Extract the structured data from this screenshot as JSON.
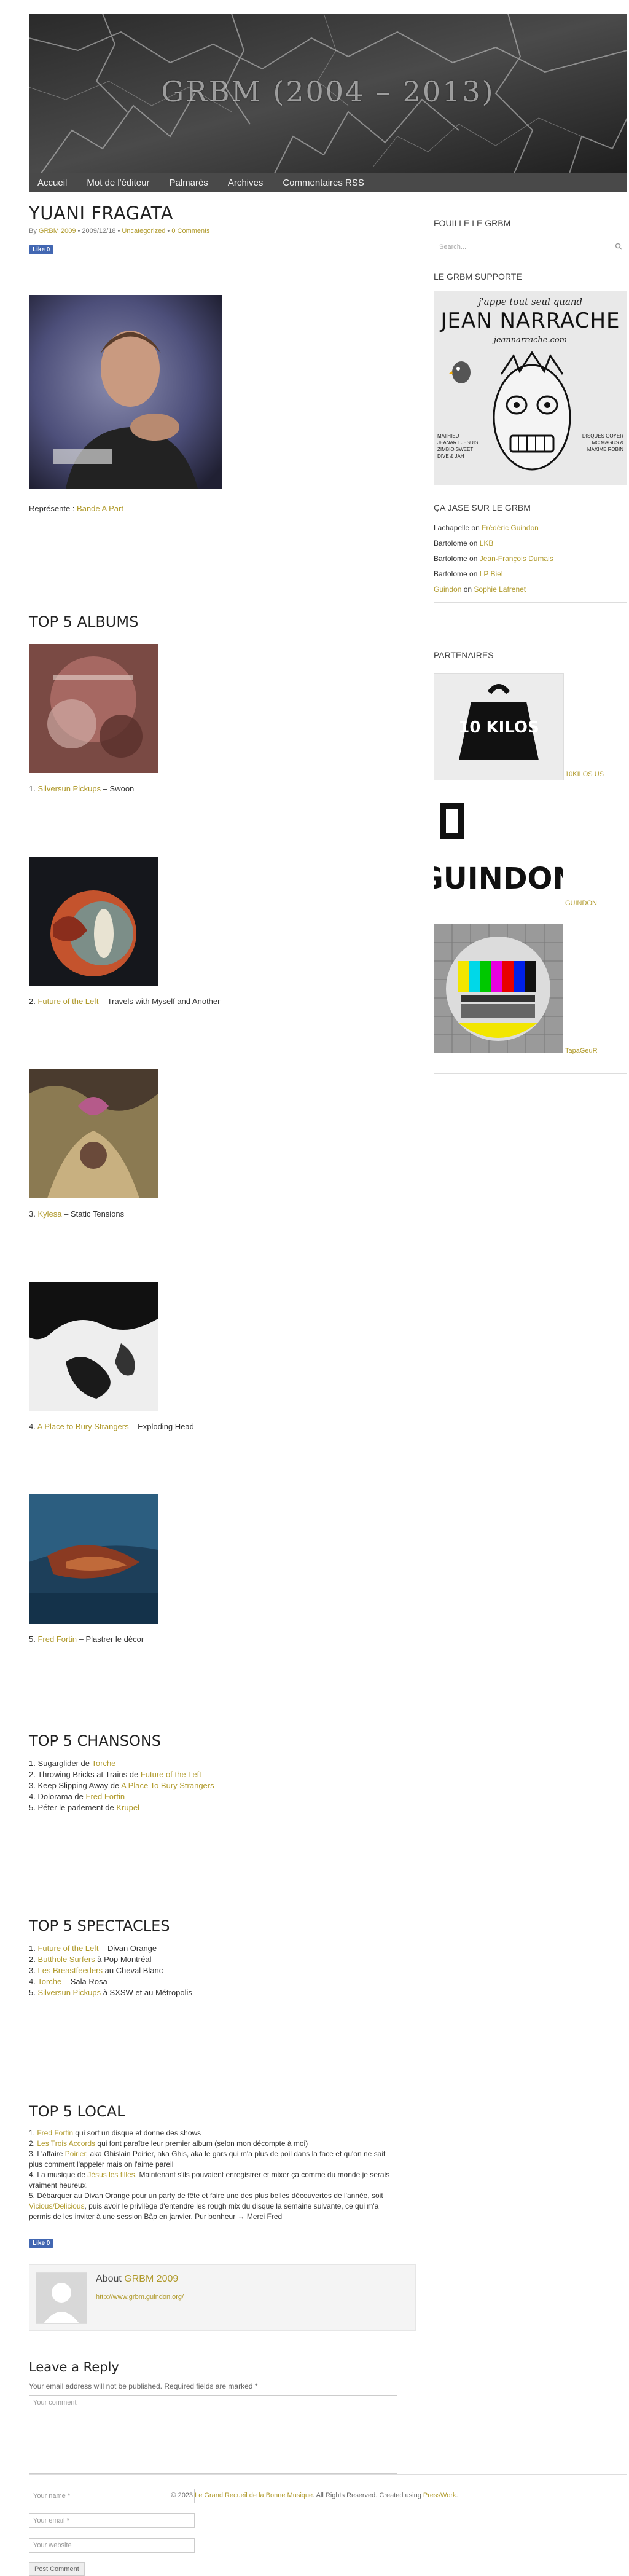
{
  "header": {
    "title": "GRBM (2004 – 2013)"
  },
  "nav": [
    "Accueil",
    "Mot de l'éditeur",
    "Palmarès",
    "Archives",
    "Commentaires RSS"
  ],
  "post": {
    "title": "YUANI FRAGATA",
    "meta_by": "By",
    "meta_author": "GRBM 2009",
    "meta_date": " • 2009/12/18 • ",
    "meta_category": "Uncategorized",
    "meta_sep": " • ",
    "meta_comments": "0 Comments",
    "like": "Like 0",
    "represents_label": "Représente : ",
    "represents_link": "Bande A Part"
  },
  "top_albums": {
    "heading": "TOP 5 ALBUMS",
    "items": [
      {
        "num": "1. ",
        "artist": "Silversun Pickups",
        "title": " – Swoon"
      },
      {
        "num": "2. ",
        "artist": "Future of the Left",
        "title": " – Travels with Myself and Another"
      },
      {
        "num": "3. ",
        "artist": "Kylesa",
        "title": " – Static Tensions"
      },
      {
        "num": "4. ",
        "artist": "A Place to Bury Strangers",
        "title": " – Exploding Head"
      },
      {
        "num": "5. ",
        "artist": "Fred Fortin",
        "title": " – Plastrer le décor"
      }
    ]
  },
  "top_songs": {
    "heading": "TOP 5 CHANSONS",
    "items": [
      {
        "text": "1. Sugarglider de ",
        "link": "Torche",
        "after": ""
      },
      {
        "text": "2. Throwing Bricks at Trains de ",
        "link": "Future of the Left",
        "after": ""
      },
      {
        "text": "3. Keep Slipping Away de ",
        "link": "A Place To Bury Strangers",
        "after": ""
      },
      {
        "text": "4. Dolorama de ",
        "link": "Fred Fortin",
        "after": ""
      },
      {
        "text": "5. Péter le parlement de ",
        "link": "Krupel",
        "after": ""
      }
    ]
  },
  "top_shows": {
    "heading": "TOP 5 SPECTACLES",
    "items": [
      {
        "text": "1. ",
        "link": "Future of the Left",
        "after": " – Divan Orange"
      },
      {
        "text": "2. ",
        "link": "Butthole Surfers",
        "after": " à Pop Montréal"
      },
      {
        "text": "3. ",
        "link": "Les Breastfeeders",
        "after": " au Cheval Blanc"
      },
      {
        "text": "4. ",
        "link": "Torche",
        "after": " – Sala Rosa"
      },
      {
        "text": "5. ",
        "link": "Silversun Pickups",
        "after": " à SXSW et au Métropolis"
      }
    ]
  },
  "top_local": {
    "heading": "TOP 5 LOCAL",
    "l1a": "1. ",
    "l1link": "Fred Fortin",
    "l1b": " qui sort un disque et donne des shows",
    "l2a": "2. ",
    "l2link": "Les Trois Accords",
    "l2b": " qui font paraître leur premier album (selon mon décompte à moi)",
    "l3a": "3. L'affaire ",
    "l3link": "Poirier",
    "l3b": ", aka Ghislain Poirier, aka Ghis, aka le gars qui m'a plus de poil dans la face et qu'on ne sait",
    "l3c": "plus comment l'appeler mais on l'aime pareil",
    "l4a": "4. La musique de ",
    "l4link": "Jésus les filles",
    "l4b": ". Maintenant s'ils pouvaient enregistrer et mixer ça comme du monde je serais",
    "l4c": "vraiment heureux.",
    "l5a": "5. Débarquer au Divan Orange pour un party de fête et faire une des plus belles découvertes de l'année, soit",
    "l5link": "Vicious/Delicious",
    "l5b": ", puis avoir le privilège d'entendre les rough mix du disque la semaine suivante, ce qui m'a",
    "l5c": "permis de les inviter à une session Bâp en janvier. Pur bonheur → Merci Fred",
    "like": "Like 0"
  },
  "author_box": {
    "about": "About ",
    "name": "GRBM 2009",
    "url": "http://www.grbm.guindon.org/"
  },
  "reply": {
    "heading": "Leave a Reply",
    "note": "Your email address will not be published. Required fields are marked *",
    "comment_placeholder": "Your comment",
    "name_placeholder": "Your name *",
    "email_placeholder": "Your email *",
    "website_placeholder": "Your website",
    "submit": "Post Comment"
  },
  "sidebar": {
    "search_heading": "FOUILLE LE GRBM",
    "search_placeholder": "Search...",
    "supports_heading": "LE GRBM SUPPORTE",
    "ad_top_text": "j'appe tout seul quand",
    "ad_name": "JEAN NARRACHE",
    "ad_url": "jeannarrache.com",
    "ad_left_text": "MATHIEU JEANART JESUIS ZIMBIO SWEET DIVE & JAH",
    "ad_right_text": "DISQUES GOYER MC MAGUS & MAXIME ROBIN",
    "comments_heading": "ÇA JASE SUR LE GRBM",
    "comments": [
      {
        "who": "Lachapelle",
        "on": " on ",
        "post": "Frédéric Guindon"
      },
      {
        "who": "Bartolome",
        "on": " on ",
        "post": "LKB"
      },
      {
        "who": "Bartolome",
        "on": " on ",
        "post": "Jean-François Dumais"
      },
      {
        "who": "Bartolome",
        "on": " on ",
        "post": "LP Biel"
      },
      {
        "who": "Guindon",
        "on": " on ",
        "post": "Sophie Lafrenet"
      }
    ],
    "partners_heading": "PARTENAIRES",
    "partners": [
      {
        "image_text": "10 KILOS",
        "label": "10KILOS US"
      },
      {
        "image_text": "GUINDON",
        "label": "GUINDON"
      },
      {
        "image_text": "",
        "label": "TapaGeuR"
      }
    ]
  },
  "footer": {
    "pre": "© 2023 ",
    "site": "Le Grand Recueil de la Bonne Musique",
    "mid": ". All Rights Reserved. Created using ",
    "theme": "PressWork",
    "post": "."
  },
  "colors": {
    "link": "#b09a2c",
    "nav": "#494949"
  }
}
